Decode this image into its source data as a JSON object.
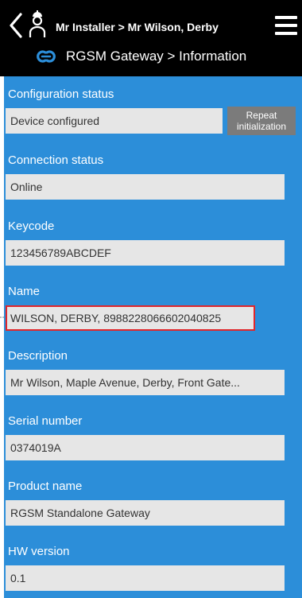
{
  "header": {
    "breadcrumb": "Mr Installer > Mr Wilson, Derby",
    "subtitle": "RGSM Gateway > Information"
  },
  "icons": {
    "back": "chevron-left-icon",
    "installer": "installer-person-icon",
    "menu": "hamburger-menu-icon",
    "gateway": "gateway-link-icon"
  },
  "colors": {
    "header_bg": "#000000",
    "content_bg": "#2c8ed9",
    "field_bg": "#e6e6e6",
    "highlight": "#e0262b",
    "button_bg": "#7b7b7b"
  },
  "fields": {
    "configuration_status": {
      "label": "Configuration status",
      "value": "Device configured"
    },
    "repeat_button": {
      "line1": "Repeat",
      "line2": "initialization"
    },
    "connection_status": {
      "label": "Connection status",
      "value": "Online"
    },
    "keycode": {
      "label": "Keycode",
      "value": "123456789ABCDEF"
    },
    "name": {
      "label": "Name",
      "value": "WILSON, DERBY, 8988228066602040825"
    },
    "description": {
      "label": "Description",
      "value": "Mr Wilson, Maple Avenue, Derby, Front Gate..."
    },
    "serial_number": {
      "label": "Serial number",
      "value": "0374019A"
    },
    "product_name": {
      "label": "Product name",
      "value": "RGSM Standalone Gateway"
    },
    "hw_version": {
      "label": "HW version",
      "value": "0.1"
    }
  }
}
